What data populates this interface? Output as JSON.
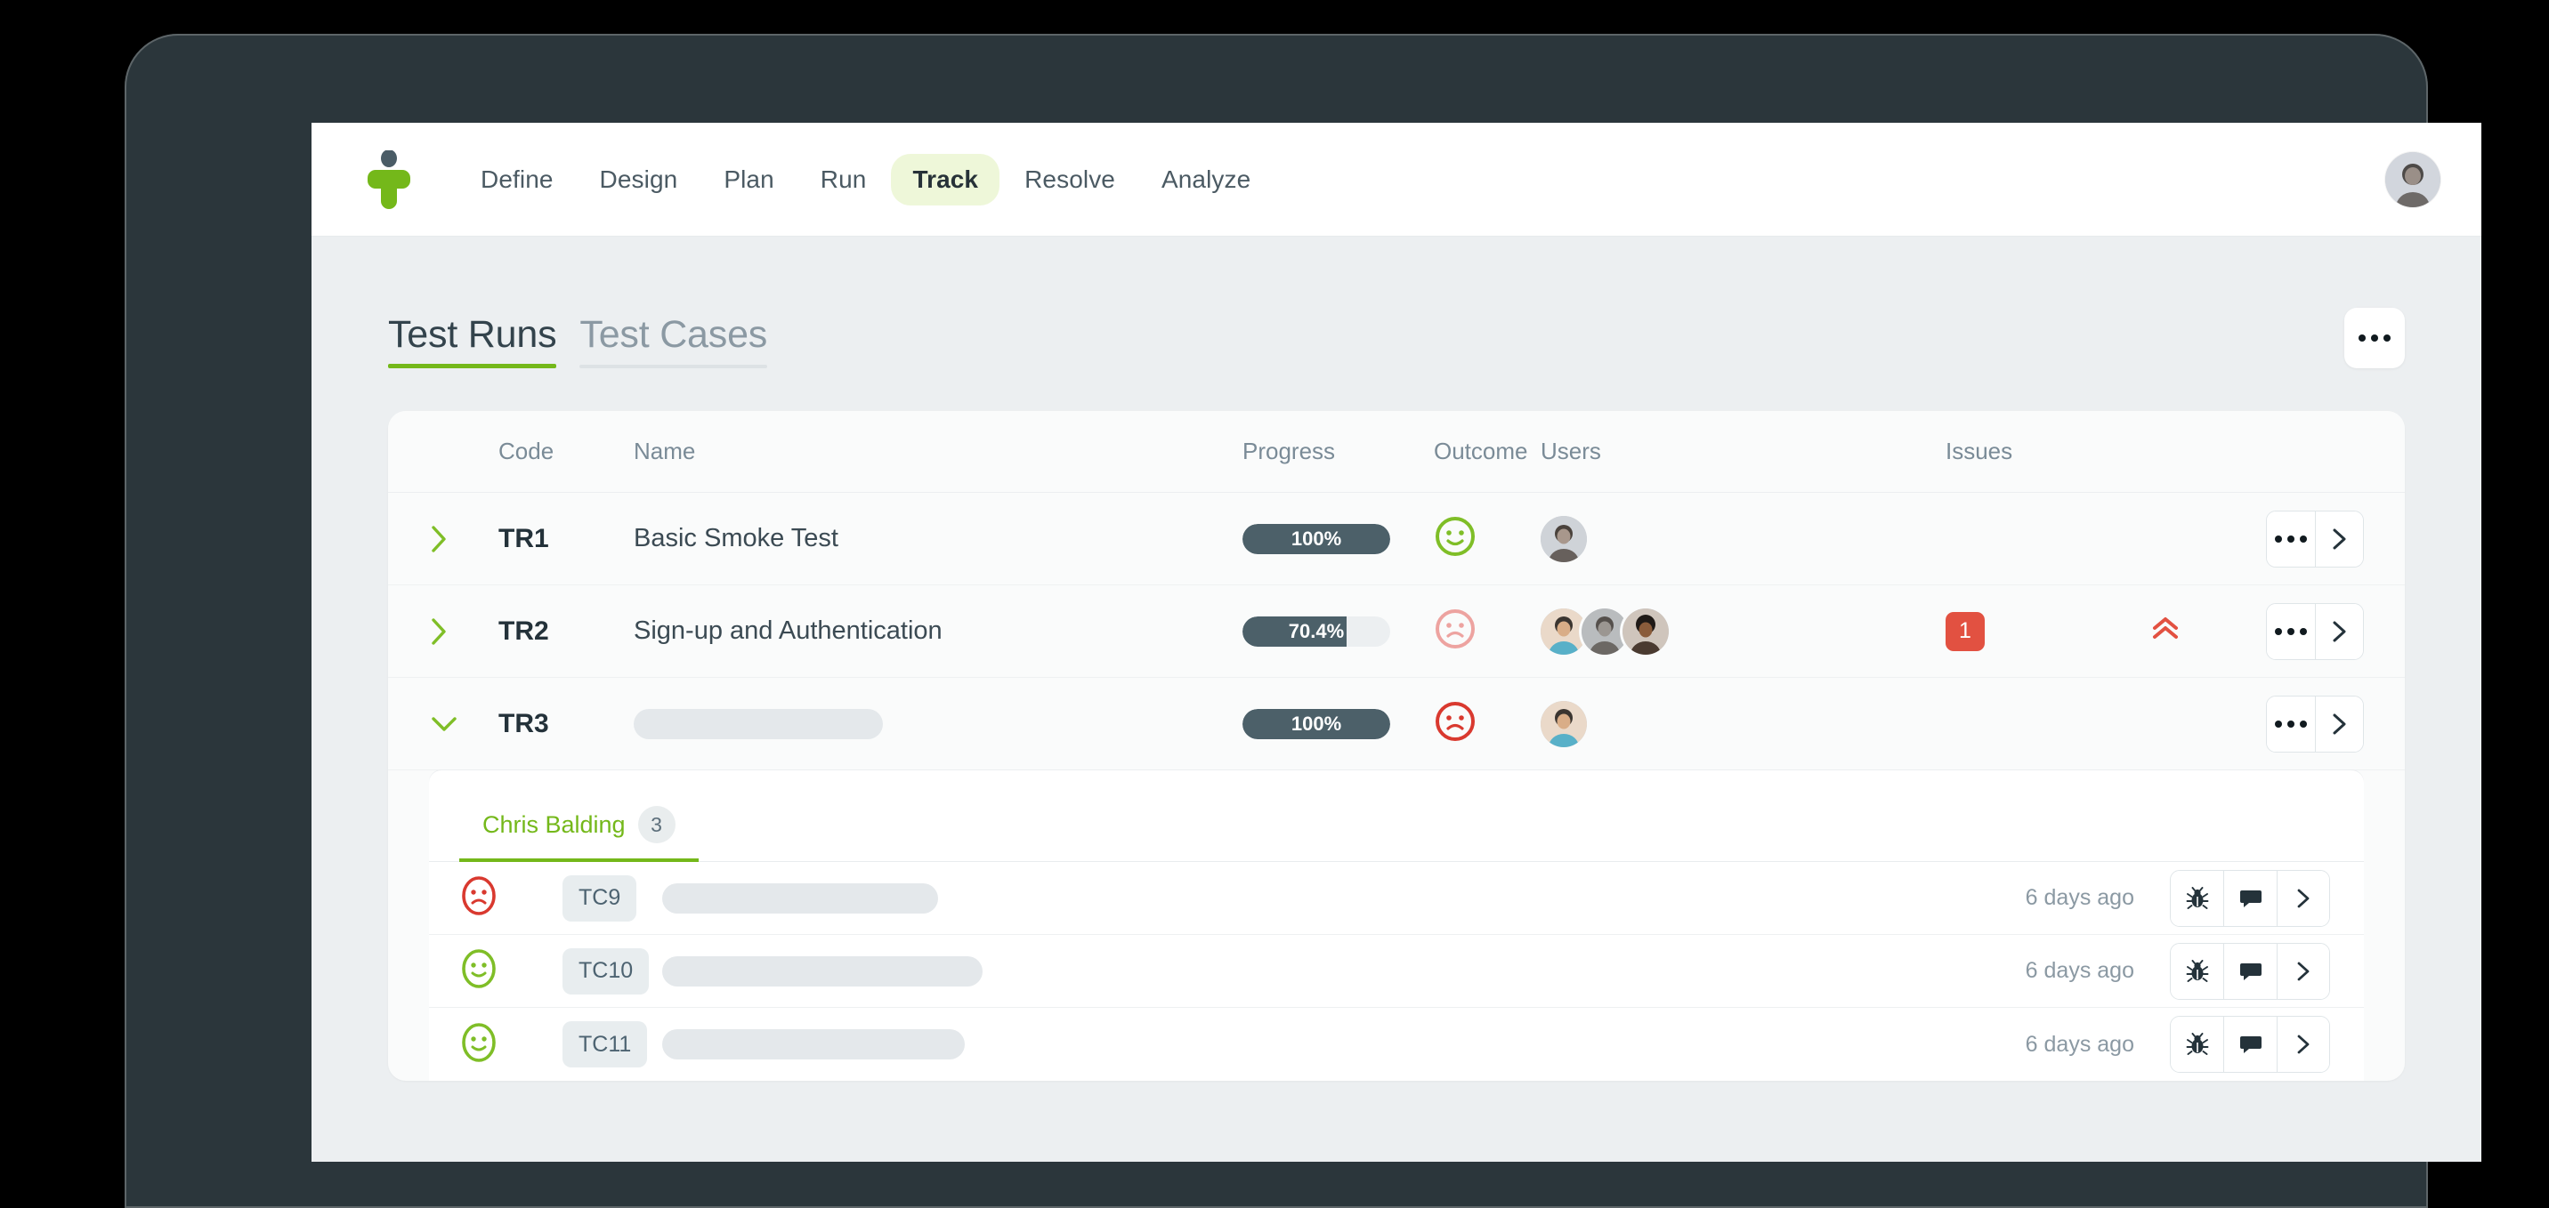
{
  "brand": {
    "logo_icon": "t-logo-icon",
    "green": "#74b81a",
    "dark": "#2b363b",
    "danger": "#e25141"
  },
  "topnav": {
    "items": [
      {
        "label": "Define",
        "active": false
      },
      {
        "label": "Design",
        "active": false
      },
      {
        "label": "Plan",
        "active": false
      },
      {
        "label": "Run",
        "active": false
      },
      {
        "label": "Track",
        "active": true
      },
      {
        "label": "Resolve",
        "active": false
      },
      {
        "label": "Analyze",
        "active": false
      }
    ],
    "avatar_name": "user-avatar"
  },
  "page": {
    "tabs": [
      {
        "label": "Test Runs",
        "active": true
      },
      {
        "label": "Test Cases",
        "active": false
      }
    ],
    "more_button_label": "•••"
  },
  "table": {
    "headers": {
      "code": "Code",
      "name": "Name",
      "progress": "Progress",
      "outcome": "Outcome",
      "users": "Users",
      "issues": "Issues"
    },
    "rows": [
      {
        "caret": "chevron-right",
        "code": "TR1",
        "name": "Basic Smoke Test",
        "name_placeholder": false,
        "progress_value": 100,
        "progress_label": "100%",
        "outcome": "pass",
        "user_count": 1,
        "issues": null,
        "priority": null
      },
      {
        "caret": "chevron-right",
        "code": "TR2",
        "name": "Sign-up and Authentication",
        "name_placeholder": false,
        "progress_value": 70.4,
        "progress_label": "70.4%",
        "outcome": "partial-fail",
        "user_count": 3,
        "issues": "1",
        "priority": "high"
      },
      {
        "caret": "chevron-down",
        "code": "TR3",
        "name": "",
        "name_placeholder": true,
        "progress_value": 100,
        "progress_label": "100%",
        "outcome": "fail",
        "user_count": 1,
        "issues": null,
        "priority": null
      }
    ]
  },
  "expanded": {
    "subtabs": [
      {
        "label": "Chris Balding",
        "count": "3",
        "active": true
      }
    ],
    "rows": [
      {
        "outcome": "fail",
        "code": "TC9",
        "name_placeholder": true,
        "name": "",
        "time": "6 days ago",
        "skeleton_width": 310
      },
      {
        "outcome": "pass",
        "code": "TC10",
        "name_placeholder": true,
        "name": "",
        "time": "6 days ago",
        "skeleton_width": 360
      },
      {
        "outcome": "pass",
        "code": "TC11",
        "name_placeholder": true,
        "name": "",
        "time": "6 days ago",
        "skeleton_width": 340
      }
    ],
    "action_icons": [
      "bug-icon",
      "comment-icon",
      "chevron-right-icon"
    ]
  }
}
